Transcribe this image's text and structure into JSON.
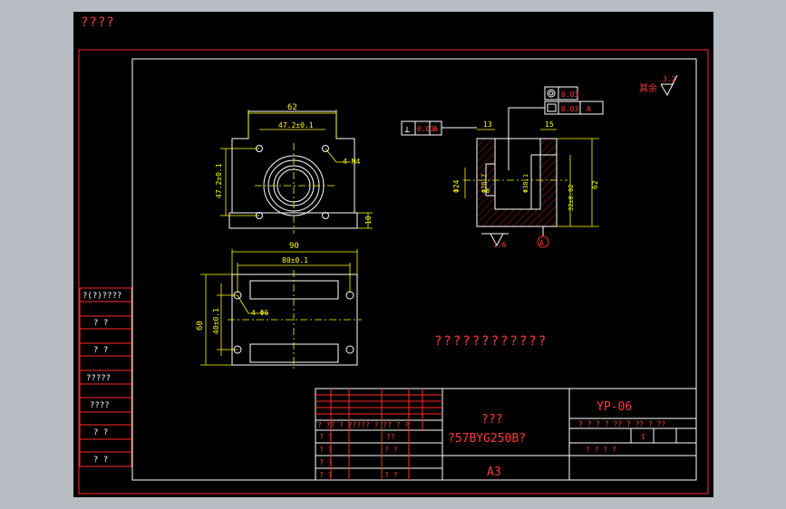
{
  "window": {
    "title": "????"
  },
  "roughness": {
    "label": "其余",
    "value": "3.2"
  },
  "front_view": {
    "dim_width_top": "62",
    "dim_bolt_spacing": "47.2±0.1",
    "dim_height_left": "47.2±0.1",
    "dim_base": "10",
    "thread_callout": "4-M4"
  },
  "bottom_view": {
    "dim_overall": "90",
    "dim_hole_spacing": "80±0.1",
    "dim_height": "60",
    "dim_height_tol": "40±0.1",
    "hole_callout": "4-Φ6"
  },
  "section_view": {
    "perp_symbol": "⊥",
    "perp_tol": "0.03",
    "perp_datum": "A",
    "dim_wall_left": "13",
    "dim_wall_right": "15",
    "coax_tol": "0.03",
    "flat_tol": "0.03",
    "flat_datum": "A",
    "dim_bore_24": "Φ24",
    "dim_bore_a": "Φ28.7",
    "dim_bore_b": "Φ38.1",
    "dim_inner_h": "32±0.02",
    "dim_height": "62",
    "dim_8": "8",
    "rough_bottom": "1.6",
    "datum_mark": "A"
  },
  "note": "????????????",
  "sidebar_labels": [
    "?(?)????",
    "?  ?",
    "?  ?",
    "?????",
    "????",
    "?  ?",
    "?  ?"
  ],
  "title_block": {
    "part_name": "???",
    "part_code": "?57BYG250B?",
    "drawing_no": "YP-06",
    "sheet_size": "A3",
    "hdr_row": "? ?? ? ????? ? ?? ? ?",
    "col_labels": "? ? ? ? ?? ? ?? ? ??",
    "scale_val": "1",
    "left_rows": [
      "? ?",
      "? ?",
      "? ?",
      "? ?"
    ],
    "mid_rows": [
      "??",
      "? ?",
      "? ?"
    ],
    "bottom_right": "?  ?  ?  ?"
  }
}
